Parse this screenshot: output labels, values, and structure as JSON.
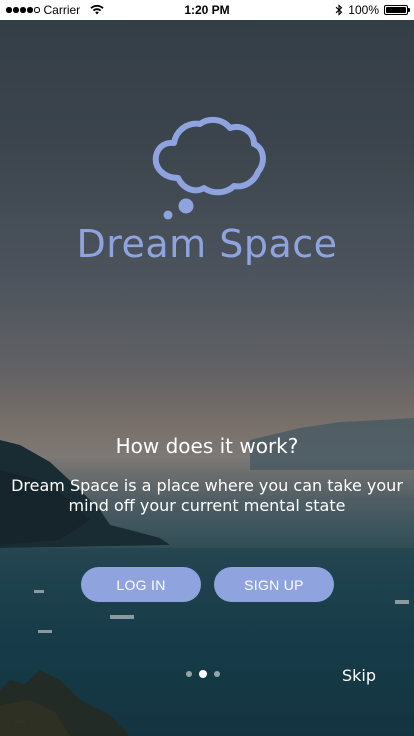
{
  "status_bar": {
    "carrier": "Carrier",
    "time": "1:20 PM",
    "battery": "100%",
    "signal_bars": 4,
    "icons": [
      "signal-icon",
      "wifi-icon",
      "bluetooth-icon",
      "battery-icon"
    ]
  },
  "brand": {
    "name": "Dream Space",
    "logo_icon": "thought-cloud-icon",
    "color": "#8fa3df"
  },
  "onboarding": {
    "headline": "How does it work?",
    "description": "Dream Space is a place where you can take your mind off your current mental state",
    "page_count": 3,
    "active_page": 2
  },
  "actions": {
    "login_label": "LOG IN",
    "signup_label": "SIGN UP",
    "skip_label": "Skip"
  },
  "colors": {
    "button": "#8fa3df",
    "text": "#ffffff",
    "status_bar_bg": "#ffffff"
  }
}
